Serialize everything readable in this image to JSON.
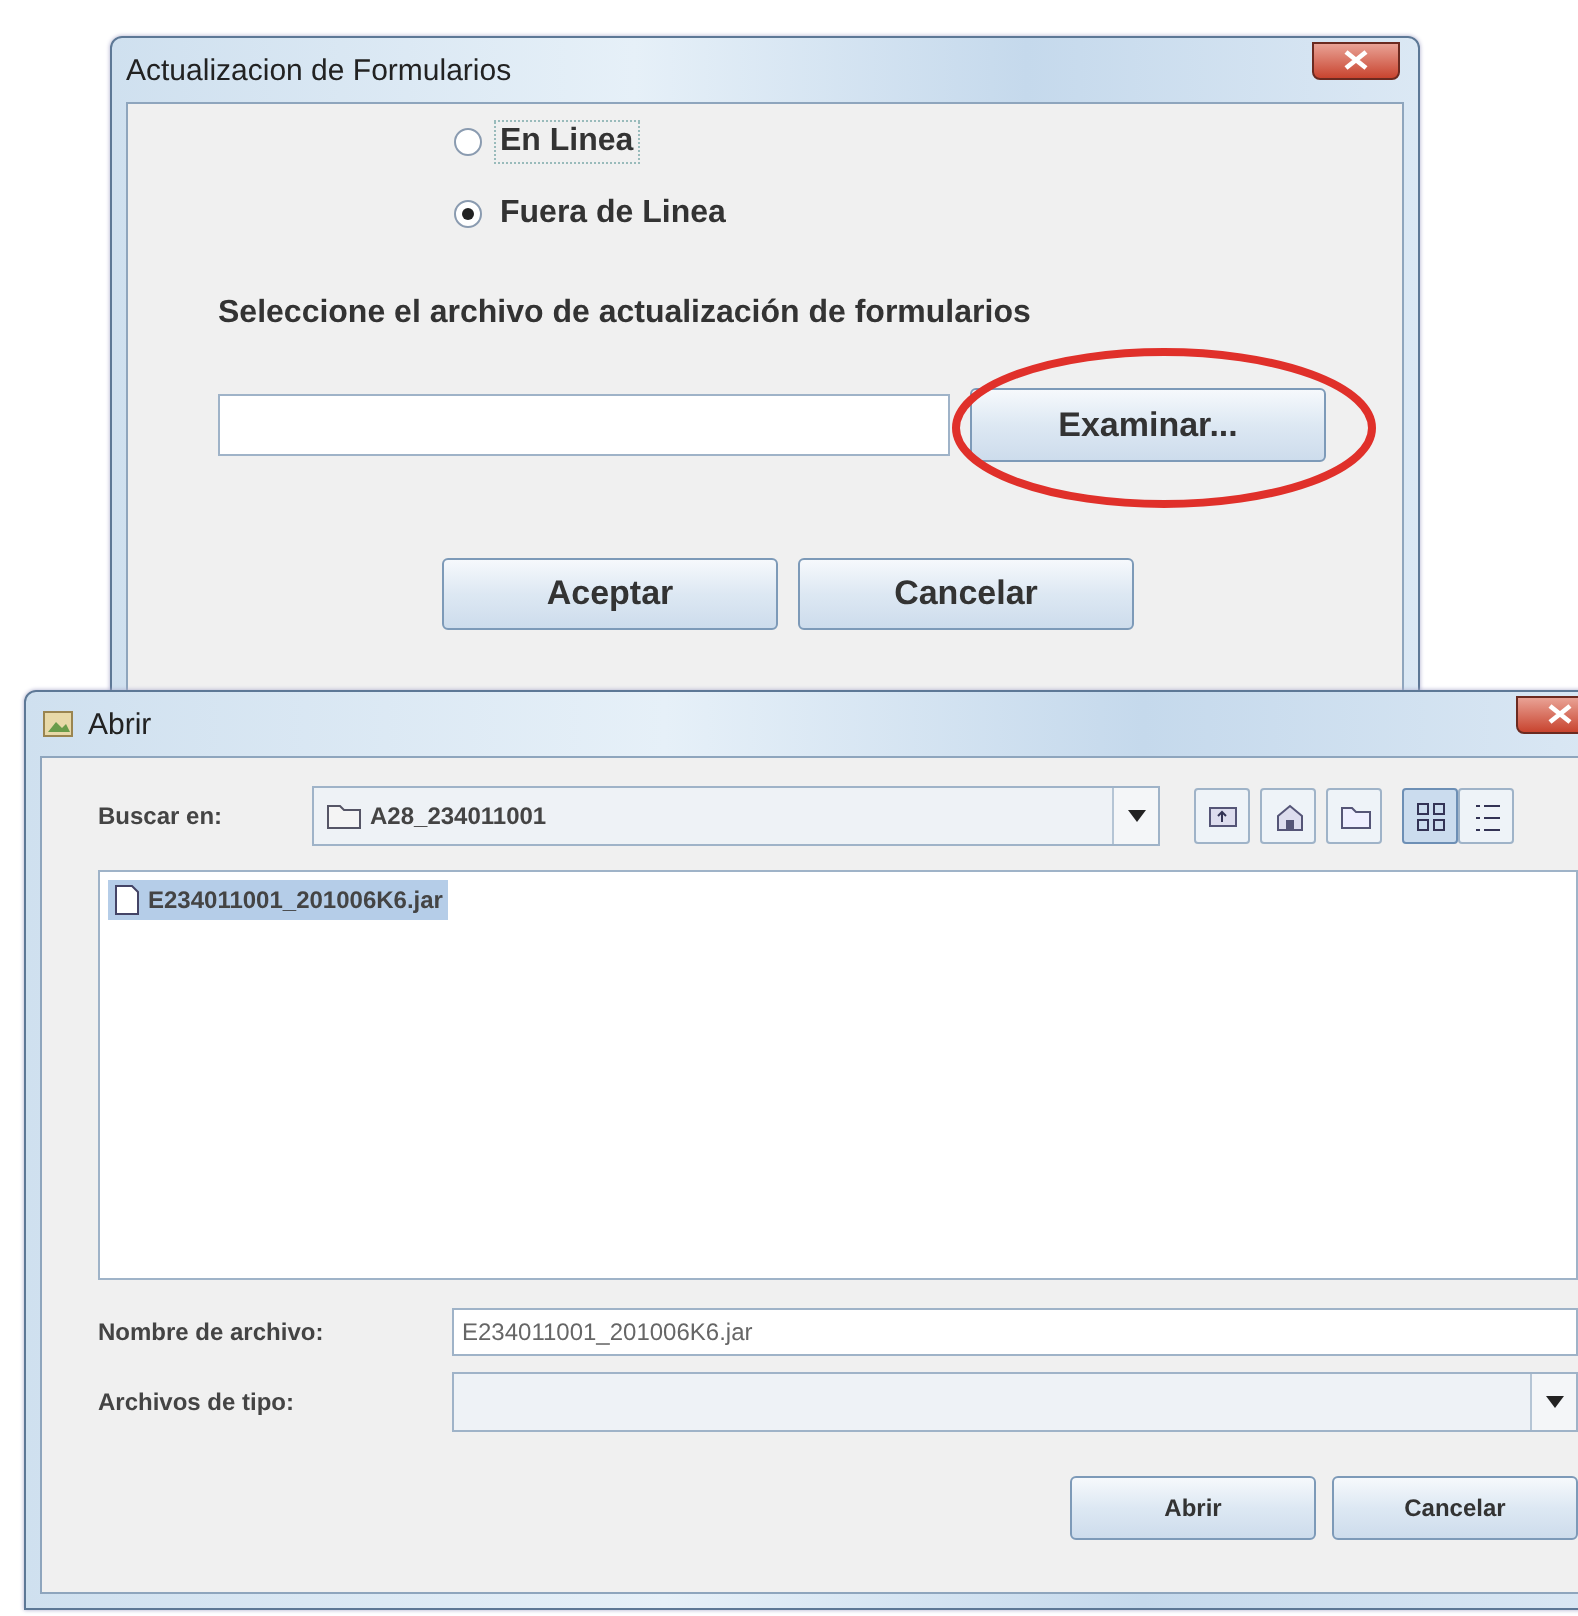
{
  "update_dialog": {
    "title": "Actualizacion de Formularios",
    "modes": [
      {
        "label": "En Linea",
        "selected": false
      },
      {
        "label": "Fuera de Linea",
        "selected": true
      }
    ],
    "prompt": "Seleccione el archivo de actualización de formularios",
    "browse_button": {
      "label": "Examinar...",
      "highlighted": true
    },
    "buttons": [
      "Aceptar",
      "Cancelar"
    ]
  },
  "open_dialog": {
    "title": "Abrir",
    "look_in": {
      "label": "Buscar en:",
      "value": "A28_234011001"
    },
    "toolbar": [
      {
        "kind": "up",
        "selected": false
      },
      {
        "kind": "home",
        "selected": false
      },
      {
        "kind": "new_folder",
        "selected": false
      },
      {
        "kind": "list",
        "selected": true
      },
      {
        "kind": "details",
        "selected": false
      }
    ],
    "files": [
      {
        "name": "E234011001_201006K6.jar",
        "selected": true
      }
    ],
    "file_name": {
      "label": "Nombre de archivo:",
      "value": "E234011001_201006K6.jar"
    },
    "file_type": {
      "label": "Archivos de tipo:"
    },
    "buttons": [
      "Abrir",
      "Cancelar"
    ]
  }
}
